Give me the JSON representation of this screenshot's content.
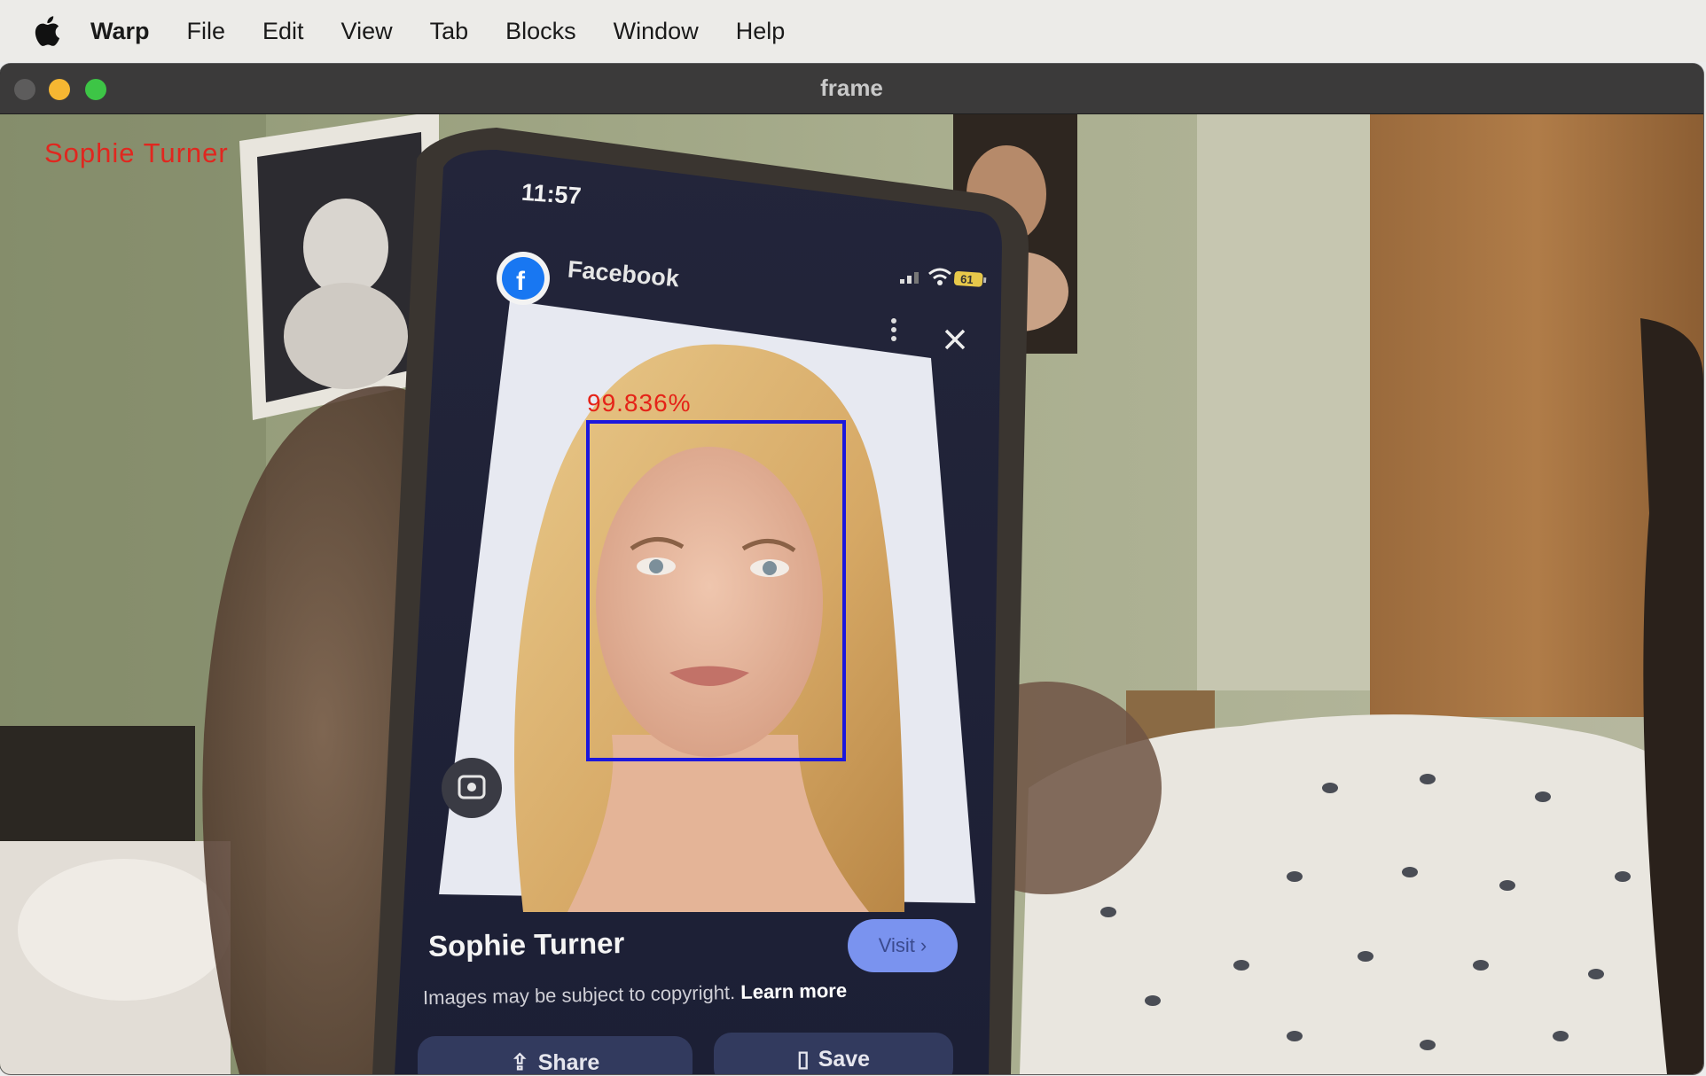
{
  "menubar": {
    "apple_icon": "apple-logo-icon",
    "app_name": "Warp",
    "items": [
      "File",
      "Edit",
      "View",
      "Tab",
      "Blocks",
      "Window",
      "Help"
    ]
  },
  "window": {
    "title": "frame"
  },
  "frame": {
    "recognized_name": "Sophie Turner",
    "confidence": "99.836%"
  },
  "phone": {
    "time": "11:57",
    "source_label": "Facebook",
    "battery": "61",
    "result_title": "Sophie Turner",
    "visit_label": "Visit",
    "copyright_text": "Images may be subject to copyright.",
    "learn_more_label": "Learn more",
    "share_label": "Share",
    "save_label": "Save"
  },
  "colors": {
    "overlay_text": "#e0271f",
    "face_box": "#1c17dc",
    "traffic_close": "#5d5c5c",
    "traffic_min": "#f6b732",
    "traffic_max": "#3dc546"
  }
}
